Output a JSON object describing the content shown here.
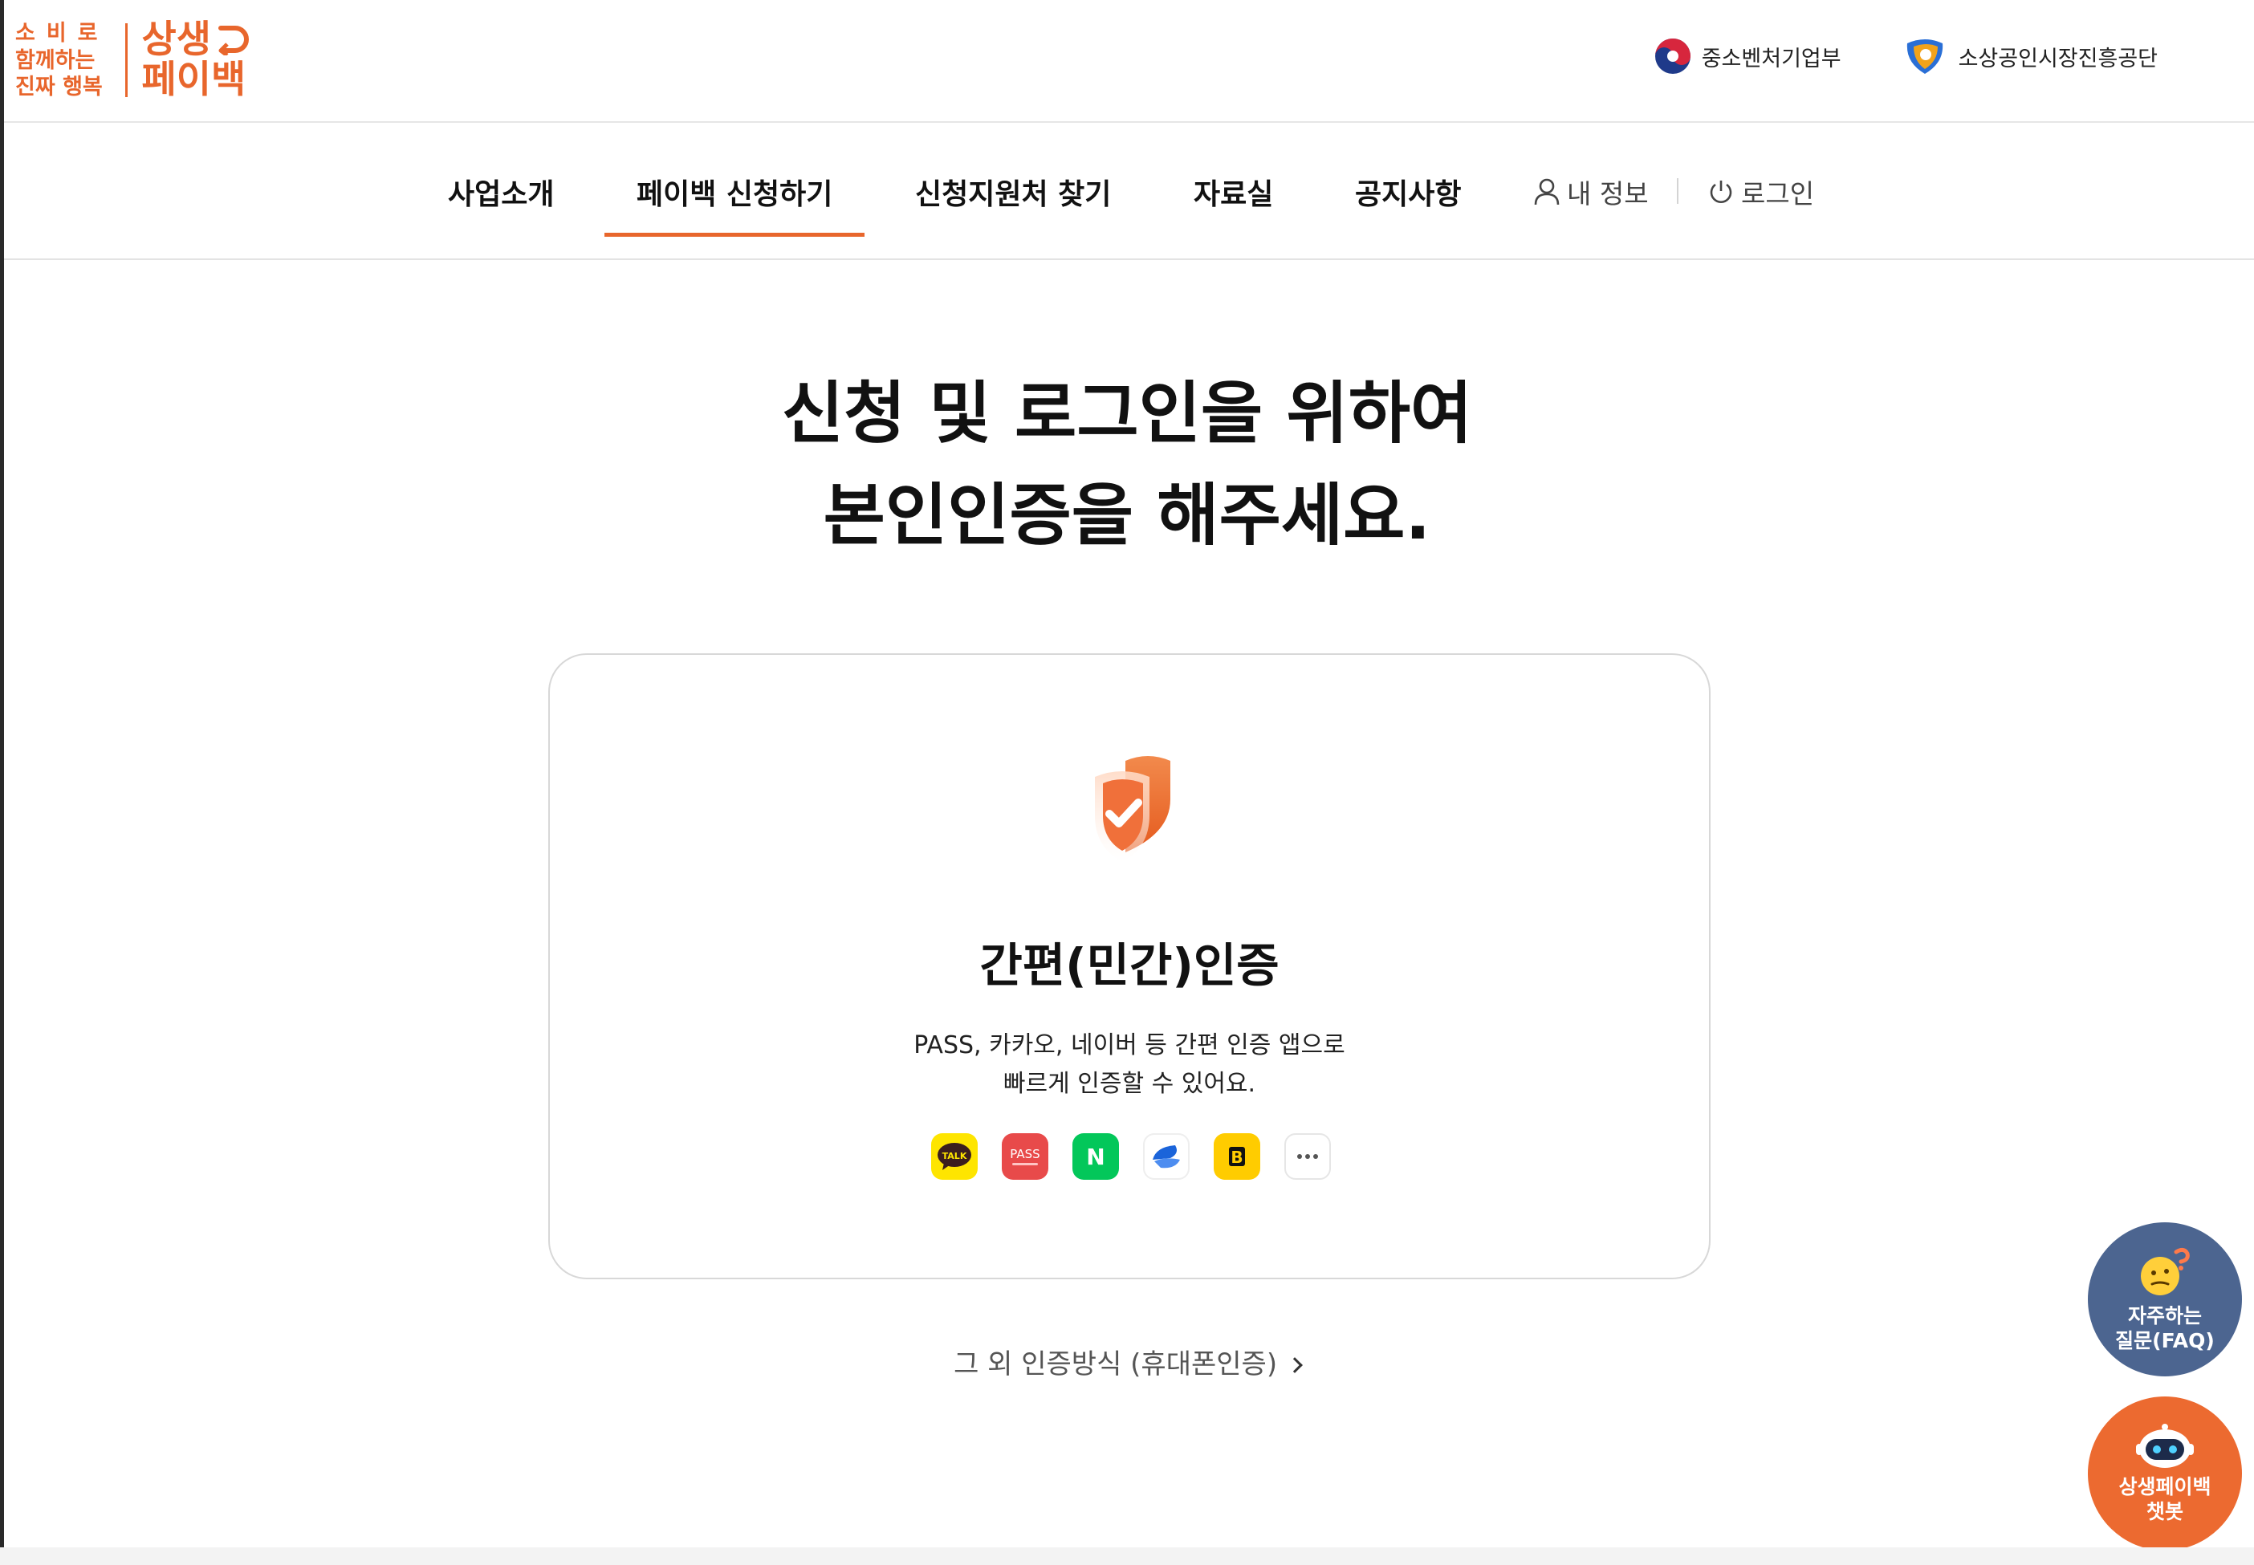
{
  "header": {
    "slogan": [
      "소비로",
      "함께하는",
      "진짜 행복"
    ],
    "brand_line1": "상생",
    "brand_line2": "페이백",
    "partners": [
      {
        "label": "중소벤처기업부",
        "icon": "mss-taegeuk-logo-icon"
      },
      {
        "label": "소상공인시장진흥공단",
        "icon": "semas-logo-icon"
      }
    ]
  },
  "nav": {
    "items": [
      "사업소개",
      "페이백 신청하기",
      "신청지원처 찾기",
      "자료실",
      "공지사항"
    ],
    "active_index": 1,
    "my_info": "내 정보",
    "login": "로그인"
  },
  "main": {
    "title_line1": "신청 및 로그인을 위하여",
    "title_line2": "본인인증을 해주세요.",
    "card": {
      "icon": "shield-check-icon",
      "title": "간편(민간)인증",
      "desc_line1": "PASS, 카카오, 네이버 등 간편 인증 앱으로",
      "desc_line2": "빠르게 인증할 수 있어요.",
      "apps": [
        {
          "name": "kakao-talk",
          "label": "TALK",
          "color": "#FEE500"
        },
        {
          "name": "pass",
          "label": "PASS",
          "color": "#E84A4A"
        },
        {
          "name": "naver",
          "label": "N",
          "color": "#03C75A"
        },
        {
          "name": "toss",
          "label": "",
          "color": "#1B64DA"
        },
        {
          "name": "kb",
          "label": "B",
          "color": "#FFCC00"
        },
        {
          "name": "more",
          "label": "···",
          "color": "#ffffff"
        }
      ]
    },
    "other_auth": "그 외 인증방식 (휴대폰인증)"
  },
  "floating": {
    "faq_line1": "자주하는",
    "faq_line2": "질문(FAQ)",
    "bot_line1": "상생페이백",
    "bot_line2": "챗봇"
  },
  "colors": {
    "accent": "#e8662c",
    "faq_bg": "#4c6590",
    "bot_bg": "#ec6a30"
  }
}
